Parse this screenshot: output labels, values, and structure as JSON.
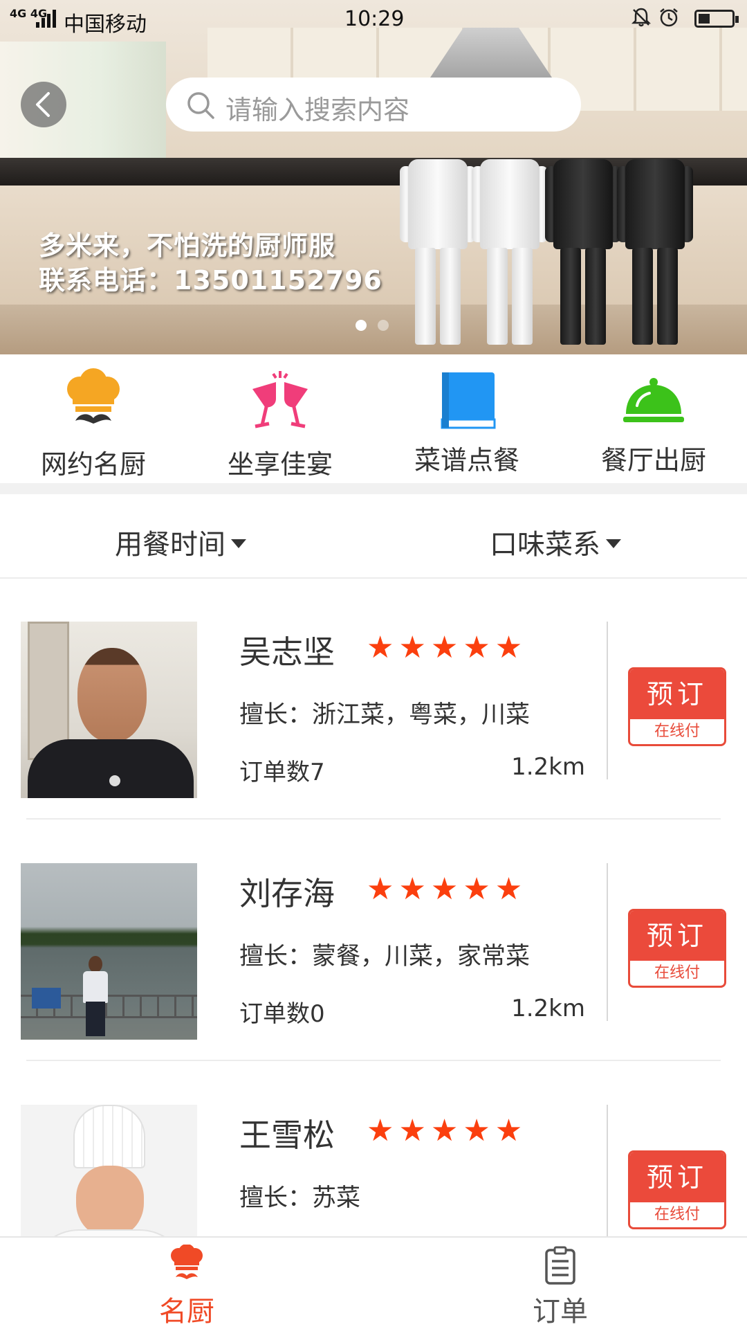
{
  "status_bar": {
    "network": "4G 4G",
    "carrier": "中国移动",
    "time": "10:29"
  },
  "search": {
    "placeholder": "请输入搜索内容"
  },
  "banner": {
    "line1": "多米来，不怕洗的厨师服",
    "line2": "联系电话：13501152796",
    "current_slide": 1,
    "slide_count": 2
  },
  "categories": [
    {
      "label": "网约名厨",
      "icon": "chef-mustache-icon",
      "color": "#f5a623"
    },
    {
      "label": "坐享佳宴",
      "icon": "wine-glasses-icon",
      "color": "#f03d7a"
    },
    {
      "label": "菜谱点餐",
      "icon": "book-icon",
      "color": "#2196f3"
    },
    {
      "label": "餐厅出厨",
      "icon": "cloche-icon",
      "color": "#3cc21a"
    }
  ],
  "filters": {
    "meal_time": "用餐时间",
    "cuisine": "口味菜系"
  },
  "chefs": [
    {
      "name": "吴志坚",
      "rating": 5,
      "stars": "★★★★★",
      "specialty": "擅长：浙江菜，粤菜，川菜",
      "orders": "订单数7",
      "distance": "1.2km",
      "book_label": "预订",
      "pay_label": "在线付"
    },
    {
      "name": "刘存海",
      "rating": 5,
      "stars": "★★★★★",
      "specialty": "擅长：蒙餐，川菜，家常菜",
      "orders": "订单数0",
      "distance": "1.2km",
      "book_label": "预订",
      "pay_label": "在线付"
    },
    {
      "name": "王雪松",
      "rating": 5,
      "stars": "★★★★★",
      "specialty": "擅长：苏菜",
      "book_label": "预订",
      "pay_label": "在线付"
    }
  ],
  "tabs": [
    {
      "label": "名厨",
      "icon": "chef-mustache-icon",
      "active": true
    },
    {
      "label": "订单",
      "icon": "clipboard-icon",
      "active": false
    }
  ],
  "colors": {
    "accent": "#f04a26",
    "star": "#fb3f0e",
    "book_button": "#eb4a3b"
  }
}
